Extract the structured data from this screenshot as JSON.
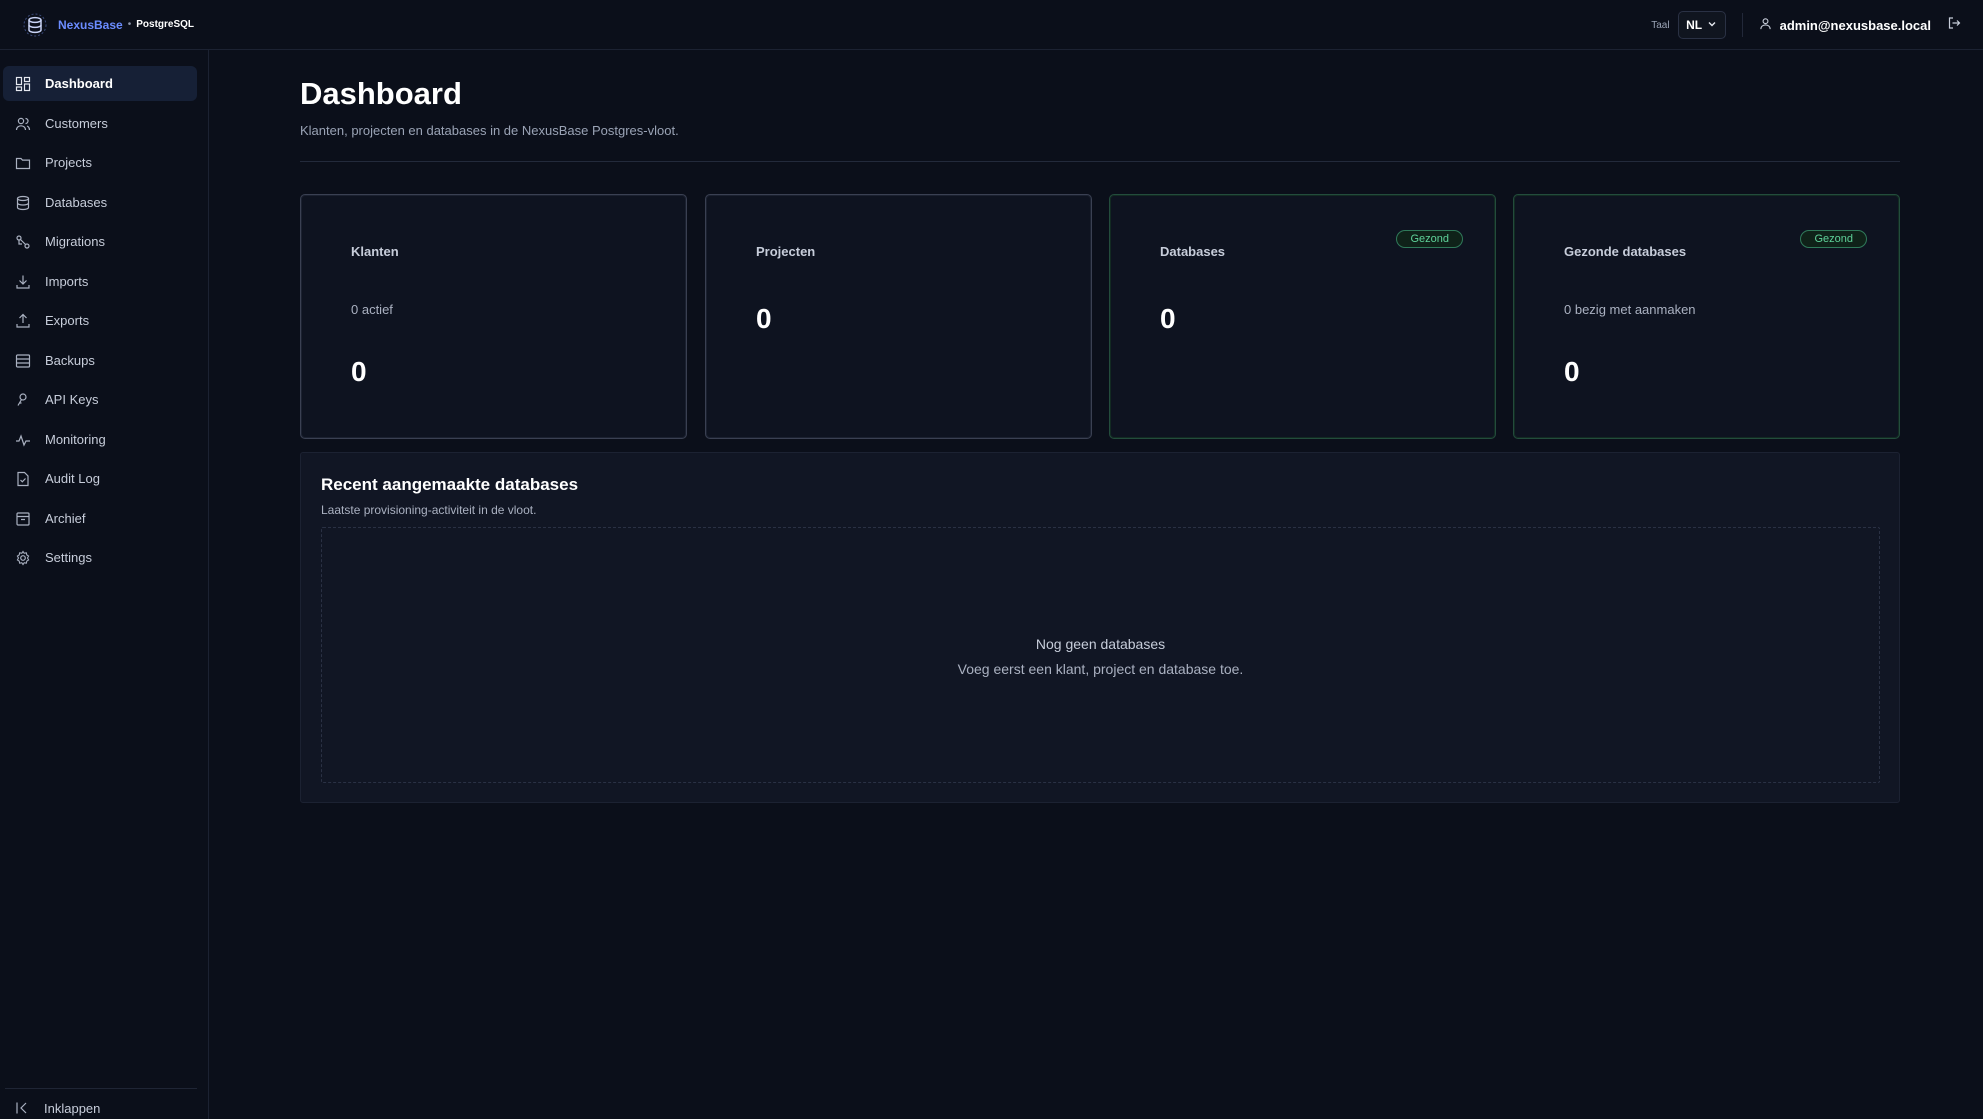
{
  "brand": {
    "name": "NexusBase",
    "separator": "•",
    "product": "PostgreSQL"
  },
  "header": {
    "language_label": "Taal",
    "language_value": "NL",
    "user_email": "admin@nexusbase.local"
  },
  "sidebar": {
    "items": [
      {
        "label": "Dashboard",
        "icon": "dashboard-icon",
        "active": true
      },
      {
        "label": "Customers",
        "icon": "users-icon"
      },
      {
        "label": "Projects",
        "icon": "folder-icon"
      },
      {
        "label": "Databases",
        "icon": "database-icon"
      },
      {
        "label": "Migrations",
        "icon": "migrations-icon"
      },
      {
        "label": "Imports",
        "icon": "download-icon"
      },
      {
        "label": "Exports",
        "icon": "upload-icon"
      },
      {
        "label": "Backups",
        "icon": "archive-box-icon"
      },
      {
        "label": "API Keys",
        "icon": "key-icon"
      },
      {
        "label": "Monitoring",
        "icon": "activity-icon"
      },
      {
        "label": "Audit Log",
        "icon": "file-icon"
      },
      {
        "label": "Archief",
        "icon": "archive-icon"
      },
      {
        "label": "Settings",
        "icon": "gear-icon"
      }
    ],
    "collapse_label": "Inklappen"
  },
  "main": {
    "title": "Dashboard",
    "subtitle": "Klanten, projecten en databases in de NexusBase Postgres-vloot.",
    "cards": [
      {
        "label": "Klanten",
        "meta": "0 actief",
        "value": "0"
      },
      {
        "label": "Projecten",
        "value": "0"
      },
      {
        "label": "Databases",
        "badge": "Gezond",
        "value": "0"
      },
      {
        "label": "Gezonde databases",
        "badge": "Gezond",
        "meta": "0 bezig met aanmaken",
        "value": "0"
      }
    ],
    "recent": {
      "title": "Recent aangemaakte databases",
      "subtitle": "Laatste provisioning-activiteit in de vloot.",
      "empty_title": "Nog geen databases",
      "empty_subtitle": "Voeg eerst een klant, project en database toe."
    }
  },
  "colors": {
    "background": "#0b0f1a",
    "accent": "#6b8cff",
    "healthy": "#5fd29a"
  }
}
